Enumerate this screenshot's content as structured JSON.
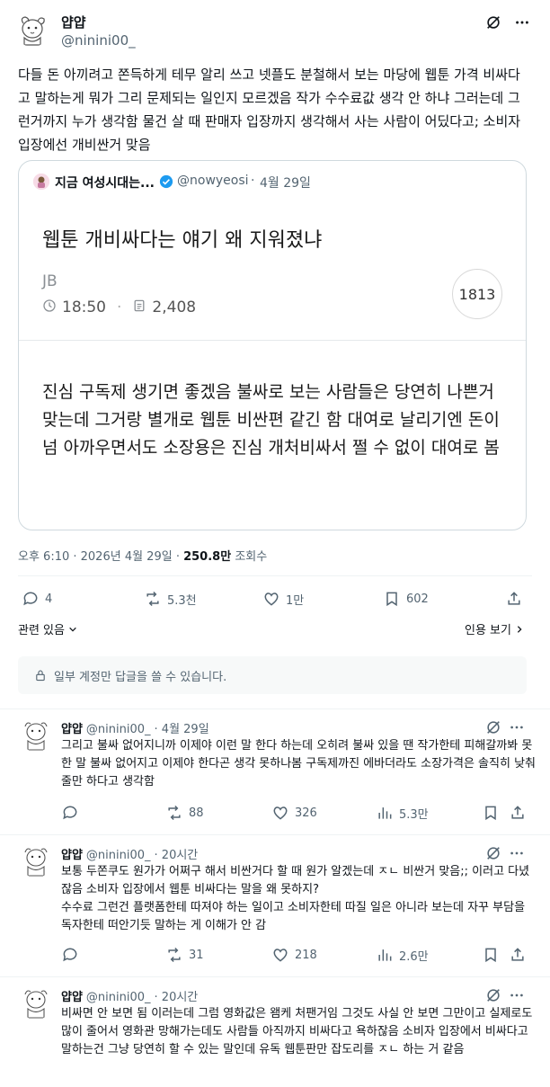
{
  "main_tweet": {
    "author_name": "얍얍",
    "author_handle": "@ninini00_",
    "body": "다들 돈 아끼려고 쫀득하게 테무 알리 쓰고 넷플도 분철해서 보는 마당에 웹툰 가격 비싸다고 말하는게 뭐가 그리 문제되는 일인지 모르겠음 작가 수수료값 생각 안 하냐 그러는데 그런거까지 누가 생각함 물건 살 때 판매자 입장까지 생각해서 사는 사람이 어딨다고; 소비자 입장에선 개비싼거 맞음",
    "timestamp": "오후 6:10 · 2026년 4월 29일 · ",
    "views_count": "250.8만",
    "views_label": " 조회수",
    "actions": {
      "replies": "4",
      "retweets": "5.3천",
      "likes": "1만",
      "bookmarks": "602"
    },
    "related_label": "관련 있음",
    "view_quotes_label": "인용 보기"
  },
  "quoted_tweet": {
    "author_name": "지금 여성시대는...",
    "author_handle": "@nowyeosi",
    "date": "4월 29일",
    "headline": "웹툰 개비싸다는 얘기 왜 지워졌냐",
    "tag": "JB",
    "time": "18:50",
    "count": "2,408",
    "comment_badge": "1813",
    "body": "진심 구독제 생기면 좋겠음 불싸로 보는 사람들은 당연히 나쁜거 맞는데 그거랑 별개로 웹툰 비싼편 같긴 함 대여로 날리기엔 돈이 넘 아까우면서도 소장용은 진심 개처비싸서 쩔 수 없이 대여로 봄"
  },
  "restricted_notice": "일부 계정만 답글을 쓸 수 있습니다.",
  "replies": [
    {
      "author_name": "얍얍",
      "author_handle": "@ninini00_",
      "time": "· 4월 29일",
      "body": "그리고 불싸 없어지니까 이제야 이런 말 한다 하는데 오히려 불싸 있을 땐 작가한테 피해갈까봐 못한 말 불싸 없어지고 이제야 한다곤 생각 못하나봄 구독제까진 에바더라도 소장가격은 솔직히 낮춰줄만 하다고 생각함",
      "replies": "",
      "retweets": "88",
      "likes": "326",
      "views": "5.3만"
    },
    {
      "author_name": "얍얍",
      "author_handle": "@ninini00_",
      "time": "· 20시간",
      "body": "보통 두쫀쿠도 원가가 어쩌구 해서 비싼거다 할 때 원가 알겠는데 ㅈㄴ 비싼거 맞음;; 이러고 다녔잖음 소비자 입장에서 웹툰 비싸다는 말을 왜 못하지?\n수수료 그런건 플랫폼한테 따져야 하는 일이고 소비자한테 따질 일은 아니라 보는데 자꾸 부담을 독자한테 떠안기듯 말하는 게 이해가 안 감",
      "replies": "",
      "retweets": "31",
      "likes": "218",
      "views": "2.6만"
    },
    {
      "author_name": "얍얍",
      "author_handle": "@ninini00_",
      "time": "· 20시간",
      "body": "비싸면 안 보면 됨 이러는데 그럼 영화값은 왬케 처팬거임 그것도 사실 안 보면 그만이고 실제로도 많이 줄어서 영화관 망해가는데도 사람들 아직까지 비싸다고 욕하잖음 소비자 입장에서 비싸다고 말하는건 그냥 당연히 할 수 있는 말인데 유독 웹툰판만 잡도리를 ㅈㄴ 하는 거 같음"
    }
  ],
  "icons": {
    "grok": "grok-icon",
    "more": "more-icon",
    "reply": "reply-icon",
    "retweet": "retweet-icon",
    "like": "like-icon",
    "bookmark": "bookmark-icon",
    "share": "share-icon",
    "views": "views-icon",
    "lock": "lock-icon",
    "clock": "clock-icon",
    "doc": "document-icon",
    "verified": "verified-badge-icon"
  },
  "colors": {
    "text": "#0f1419",
    "muted": "#536471",
    "border": "#cfd9de",
    "verified": "#1d9bf0"
  }
}
